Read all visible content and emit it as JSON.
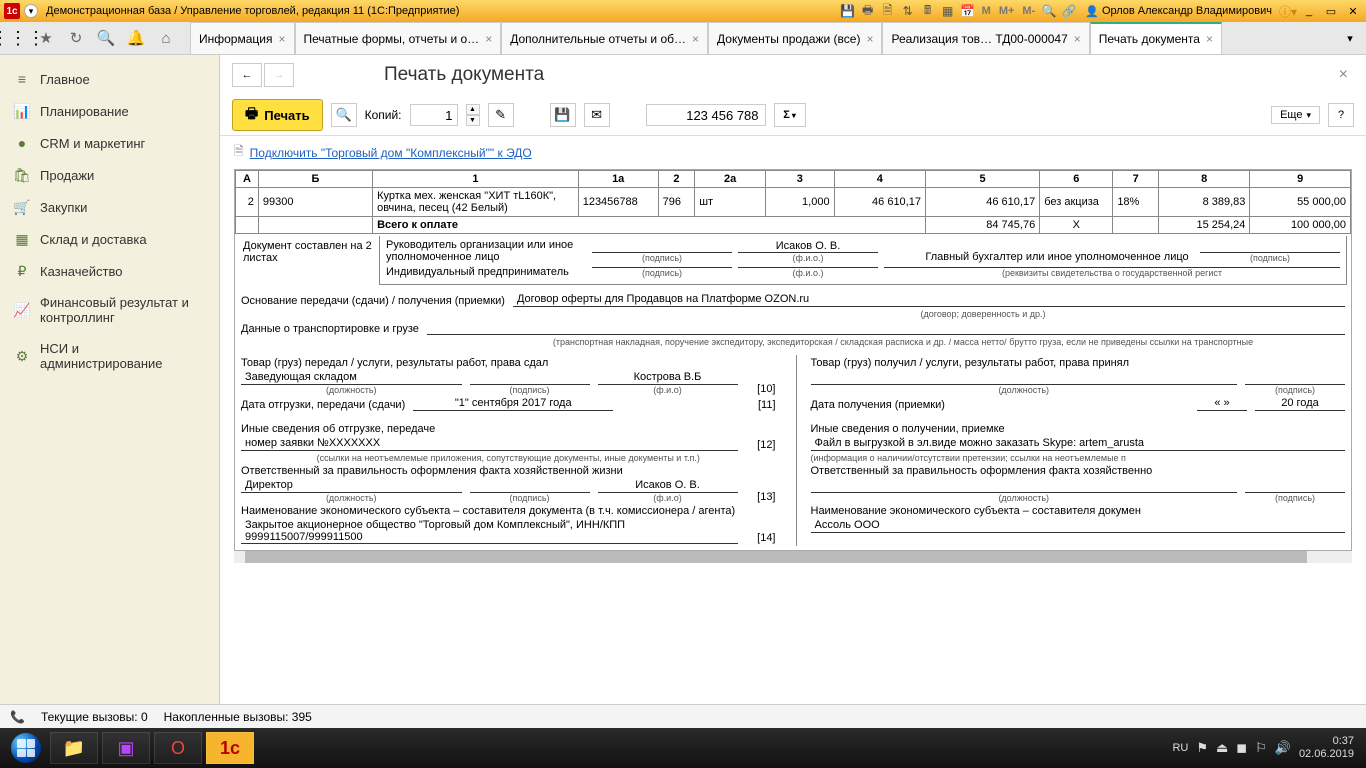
{
  "titlebar": {
    "title": "Демонстрационная база / Управление торговлей, редакция 11  (1С:Предприятие)",
    "user": "Орлов Александр Владимирович",
    "mem": [
      "M",
      "M+",
      "M-"
    ]
  },
  "tabs": [
    {
      "label": "Информация",
      "active": false
    },
    {
      "label": "Печатные формы, отчеты и о…",
      "active": false
    },
    {
      "label": "Дополнительные отчеты и об…",
      "active": false
    },
    {
      "label": "Документы продажи (все)",
      "active": false
    },
    {
      "label": "Реализация тов… ТД00-000047",
      "active": false
    },
    {
      "label": "Печать документа",
      "active": true
    }
  ],
  "sidebar": {
    "items": [
      {
        "icon": "≡",
        "label": "Главное"
      },
      {
        "icon": "📊",
        "label": "Планирование"
      },
      {
        "icon": "●",
        "label": "CRM и маркетинг"
      },
      {
        "icon": "🛍",
        "label": "Продажи"
      },
      {
        "icon": "🛒",
        "label": "Закупки"
      },
      {
        "icon": "▦",
        "label": "Склад и доставка"
      },
      {
        "icon": "₽",
        "label": "Казначейство"
      },
      {
        "icon": "📈",
        "label": "Финансовый результат и контроллинг"
      },
      {
        "icon": "⚙",
        "label": "НСИ и администрирование"
      }
    ]
  },
  "page": {
    "title": "Печать документа",
    "print_label": "Печать",
    "copies_label": "Копий:",
    "copies_value": "1",
    "sum_value": "123 456 788",
    "more_label": "Еще"
  },
  "edo": {
    "text": "Подключить \"Торговый дом \"Комплексный\"\" к ЭДО"
  },
  "table": {
    "headers": [
      "А",
      "Б",
      "1",
      "1а",
      "2",
      "2а",
      "3",
      "4",
      "5",
      "6",
      "7",
      "8",
      "9"
    ],
    "row": {
      "a": "2",
      "b": "99300",
      "c1": "Куртка мех. женская \"ХИТ тL160К\", овчина, песец (42 Белый)",
      "c1a": "123456788",
      "c2": "796",
      "c2a": "шт",
      "c3": "1,000",
      "c4": "46 610,17",
      "c5": "46 610,17",
      "c6": "без акциза",
      "c7": "18%",
      "c8": "8 389,83",
      "c9": "55 000,00"
    },
    "total_label": "Всего к оплате",
    "totals": {
      "c5": "84 745,76",
      "c6": "Х",
      "c8": "15 254,24",
      "c9": "100 000,00"
    }
  },
  "doc_footer": {
    "pages": "Документ составлен на 2 листах",
    "head_label": "Руководитель организации или иное уполномоченное лицо",
    "head_name": "Исаков О. В.",
    "ip_label": "Индивидуальный предприниматель",
    "chief_acc_label": "Главный бухгалтер или иное уполномоченное лицо",
    "podpis": "(подпись)",
    "fio": "(ф.и.о.)",
    "rekvizit": "(реквизиты свидетельства о государственной регист"
  },
  "form": {
    "basis_label": "Основание передачи (сдачи) / получения (приемки)",
    "basis_value": "Договор оферты для Продавцов на Платформе OZON.ru",
    "basis_hint": "(договор; доверенность и др.)",
    "transport_label": "Данные о транспортировке и грузе",
    "transport_hint": "(транспортная накладная, поручение экспедитору, экспедиторская / складская расписка и др. / масса нетто/ брутто груза, если не приведены ссылки на транспортные",
    "left": {
      "handed_label": "Товар (груз) передал / услуги, результаты работ, права сдал",
      "position": "Заведующая складом",
      "name": "Кострова В.Б",
      "num10": "[10]",
      "ship_date_label": "Дата отгрузки, передачи (сдачи)",
      "ship_date": "\"1\" сентября 2017 года",
      "num11": "[11]",
      "other_info_label": "Иные сведения об отгрузке, передаче",
      "other_info": "номер заявки №ХХХХХХХ",
      "other_hint": "(ссылки на неотъемлемые приложения, сопутствующие документы, иные документы и т.п.)",
      "num12": "[12]",
      "resp_label": "Ответственный за правильность оформления факта хозяйственной жизни",
      "resp_pos": "Директор",
      "resp_name": "Исаков О. В.",
      "num13": "[13]",
      "entity_label": "Наименование экономического субъекта – составителя документа (в т.ч. комиссионера / агента)",
      "entity_value": "Закрытое акционерное общество \"Торговый дом Комплексный\", ИНН/КПП 9999115007/999911500",
      "num14": "[14]"
    },
    "right": {
      "received_label": "Товар (груз) получил / услуги, результаты работ, права принял",
      "recv_date_label": "Дата получения (приемки)",
      "recv_date_q": "«     »",
      "recv_date_y": "20        года",
      "other_info_label": "Иные сведения о получении, приемке",
      "other_info": "Файл в выгрузкой в эл.виде можно заказать Skype: artem_arusta",
      "other_hint": "(информация о наличии/отсутствии претензии; ссылки на неотъемлемые п",
      "resp_label": "Ответственный за правильность оформления факта хозяйственно",
      "entity_label": "Наименование экономического субъекта – составителя докумен",
      "entity_value": "Ассоль ООО"
    },
    "pos_hint": "(должность)",
    "sig_hint": "(подпись)",
    "fio_hint": "(ф.и.о)"
  },
  "status": {
    "calls": "Текущие вызовы:  0",
    "accum": "Накопленные вызовы: 395"
  },
  "taskbar": {
    "lang": "RU",
    "time": "0:37",
    "date": "02.06.2019"
  }
}
